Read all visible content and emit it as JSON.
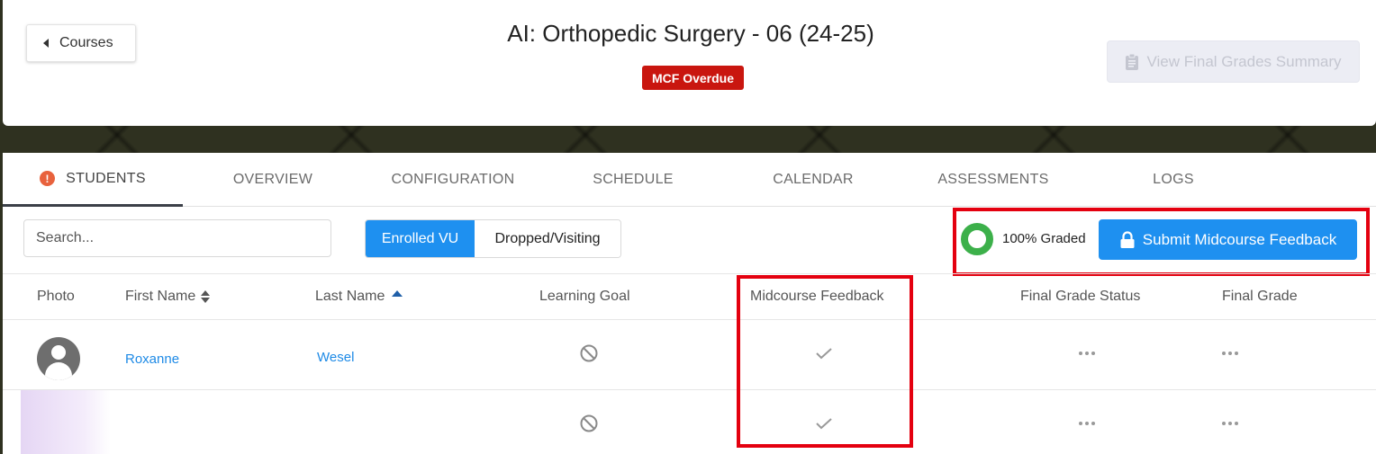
{
  "header": {
    "back_label": "Courses",
    "course_title": "AI: Orthopedic Surgery - 06 (24-25)",
    "status_badge": "MCF Overdue",
    "final_summary_label": "View Final Grades Summary"
  },
  "tabs": [
    {
      "label": "STUDENTS",
      "active": true,
      "alert": "!"
    },
    {
      "label": "OVERVIEW"
    },
    {
      "label": "CONFIGURATION"
    },
    {
      "label": "SCHEDULE"
    },
    {
      "label": "CALENDAR"
    },
    {
      "label": "ASSESSMENTS"
    },
    {
      "label": "LOGS"
    }
  ],
  "toolbar": {
    "search_placeholder": "Search...",
    "enrolled_label": "Enrolled VU",
    "dropped_label": "Dropped/Visiting",
    "graded_text": "100% Graded",
    "graded_percent": 100,
    "submit_label": "Submit Midcourse Feedback"
  },
  "table": {
    "columns": [
      "Photo",
      "First Name",
      "Last Name",
      "Learning Goal",
      "Midcourse Feedback",
      "Final Grade Status",
      "Final Grade"
    ],
    "rows": [
      {
        "first_name": "Roxanne",
        "last_name": "Wesel",
        "learning_goal": "none",
        "midcourse_feedback": "done",
        "final_grade_status": "...",
        "final_grade": "..."
      },
      {
        "first_name": "",
        "last_name": "",
        "learning_goal": "none",
        "midcourse_feedback": "done",
        "final_grade_status": "...",
        "final_grade": "..."
      }
    ]
  },
  "colors": {
    "accent": "#1e90f0",
    "badge_red": "#c9160f",
    "highlight_red": "#e4000f",
    "progress_green": "#3cb04a",
    "alert_orange": "#e8623d"
  },
  "icons": {
    "back": "caret-left-icon",
    "summary": "clipboard-icon",
    "alert": "alert-circle-icon",
    "submit": "lock-icon",
    "sort": "sort-icon",
    "sort_asc": "sort-ascending-icon",
    "learning_goal": "not-allowed-icon",
    "feedback": "checkmark-icon",
    "more": "ellipsis-icon"
  }
}
